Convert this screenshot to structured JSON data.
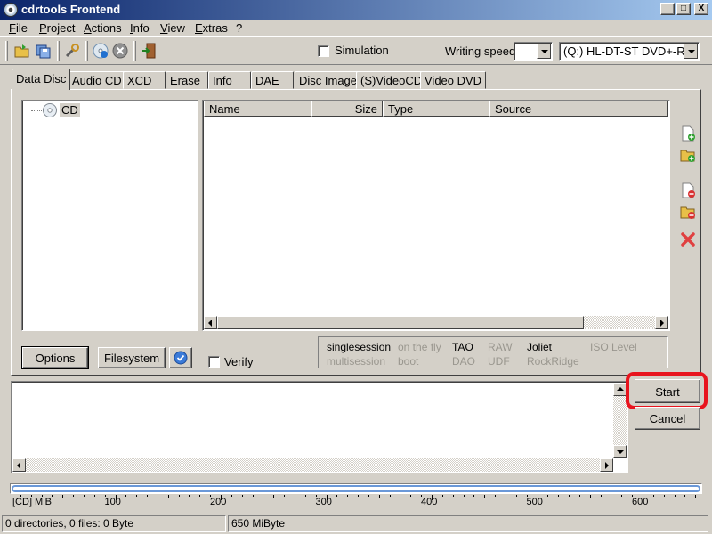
{
  "window": {
    "title": "cdrtools Frontend",
    "min_label": "_",
    "max_label": "□",
    "close_label": "X"
  },
  "menu": [
    "File",
    "Project",
    "Actions",
    "Info",
    "View",
    "Extras",
    "?"
  ],
  "toolbar": {
    "simulation_label": "Simulation",
    "simulation_checked": false,
    "writing_speed_label": "Writing speed",
    "writing_speed_value": "",
    "drive_value": "(Q:) HL-DT-ST DVD+-RW"
  },
  "tabs": [
    "Data Disc",
    "Audio CD",
    "XCD",
    "Erase",
    "Info",
    "DAE",
    "Disc Image",
    "(S)VideoCD",
    "Video DVD"
  ],
  "active_tab": "Data Disc",
  "tree": {
    "root_label": "CD"
  },
  "file_list": {
    "columns": [
      "Name",
      "Size",
      "Type",
      "Source"
    ],
    "rows": []
  },
  "buttons": {
    "options": "Options",
    "filesystem": "Filesystem",
    "verify_label": "Verify",
    "verify_checked": false,
    "start": "Start",
    "cancel": "Cancel"
  },
  "flags": {
    "row1": [
      {
        "label": "singlesession",
        "enabled": true
      },
      {
        "label": "on the fly",
        "enabled": false
      },
      {
        "label": "TAO",
        "enabled": true
      },
      {
        "label": "RAW",
        "enabled": false
      },
      {
        "label": "Joliet",
        "enabled": true
      },
      {
        "label": "ISO Level",
        "enabled": false
      }
    ],
    "row2": [
      {
        "label": "multisession",
        "enabled": false
      },
      {
        "label": "boot",
        "enabled": false
      },
      {
        "label": "DAO",
        "enabled": false
      },
      {
        "label": "UDF",
        "enabled": false
      },
      {
        "label": "RockRidge",
        "enabled": false
      }
    ]
  },
  "log": {
    "text": ""
  },
  "capacity": {
    "unit_label": "[CD] MiB",
    "ticks": [
      "100",
      "200",
      "300",
      "400",
      "500",
      "600"
    ],
    "used_fraction": 0
  },
  "status": {
    "left": "0 directories, 0 files: 0 Byte",
    "right": "650 MiByte"
  },
  "highlight_color": "#e8141e"
}
